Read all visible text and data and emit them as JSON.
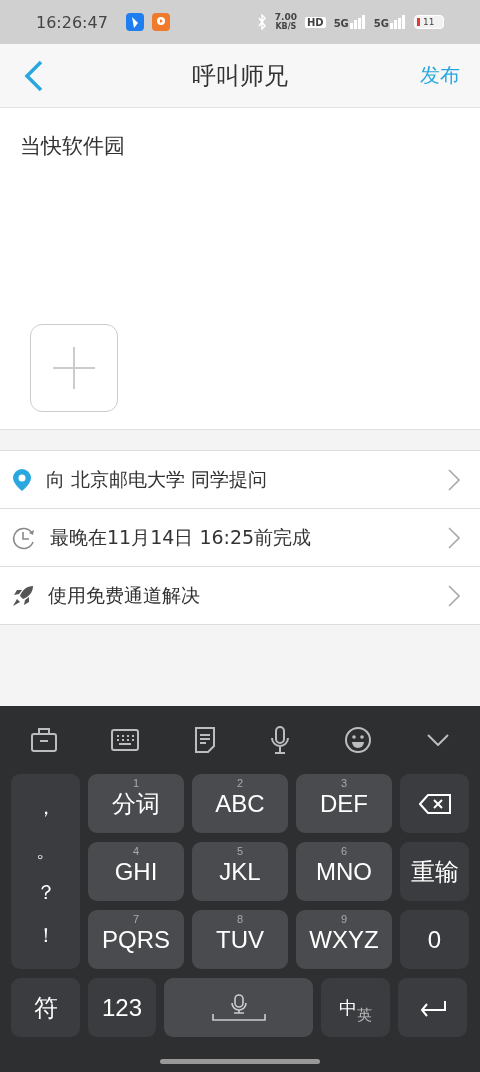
{
  "status_bar": {
    "time": "16:26:47",
    "net_speed": "7.00",
    "net_unit": "KB/S",
    "hd": "HD",
    "sim_1": "5G",
    "sim_2": "5G",
    "battery": "11"
  },
  "nav": {
    "title": "呼叫师兄",
    "action": "发布"
  },
  "post": {
    "text": "当快软件园"
  },
  "options": [
    {
      "kind": "location",
      "text": "向 北京邮电大学 同学提问"
    },
    {
      "kind": "deadline",
      "text": "最晚在11月14日 16:25前完成"
    },
    {
      "kind": "channel",
      "text": "使用免费通道解决"
    }
  ],
  "keyboard": {
    "toolbar": [
      {
        "kind": "toolbox"
      },
      {
        "kind": "keyboard"
      },
      {
        "kind": "clipboard"
      },
      {
        "kind": "voice"
      },
      {
        "kind": "emoji"
      },
      {
        "kind": "collapse"
      }
    ],
    "punctuation": [
      "，",
      "。",
      "？",
      "！"
    ],
    "keys": [
      {
        "hint": "1",
        "label": "分词"
      },
      {
        "hint": "2",
        "label": "ABC"
      },
      {
        "hint": "3",
        "label": "DEF"
      },
      {
        "hint": "4",
        "label": "GHI"
      },
      {
        "hint": "5",
        "label": "JKL"
      },
      {
        "hint": "6",
        "label": "MNO"
      },
      {
        "hint": "7",
        "label": "PQRS"
      },
      {
        "hint": "8",
        "label": "TUV"
      },
      {
        "hint": "9",
        "label": "WXYZ"
      }
    ],
    "side_keys": [
      {
        "kind": "backspace"
      },
      {
        "kind": "text",
        "label": "重输"
      },
      {
        "kind": "text",
        "label": "0"
      }
    ],
    "bottom_keys": [
      {
        "kind": "text",
        "label": "符"
      },
      {
        "kind": "text",
        "label": "123"
      },
      {
        "kind": "space"
      },
      {
        "kind": "lang",
        "main": "中",
        "alt": "英"
      },
      {
        "kind": "enter"
      }
    ]
  }
}
